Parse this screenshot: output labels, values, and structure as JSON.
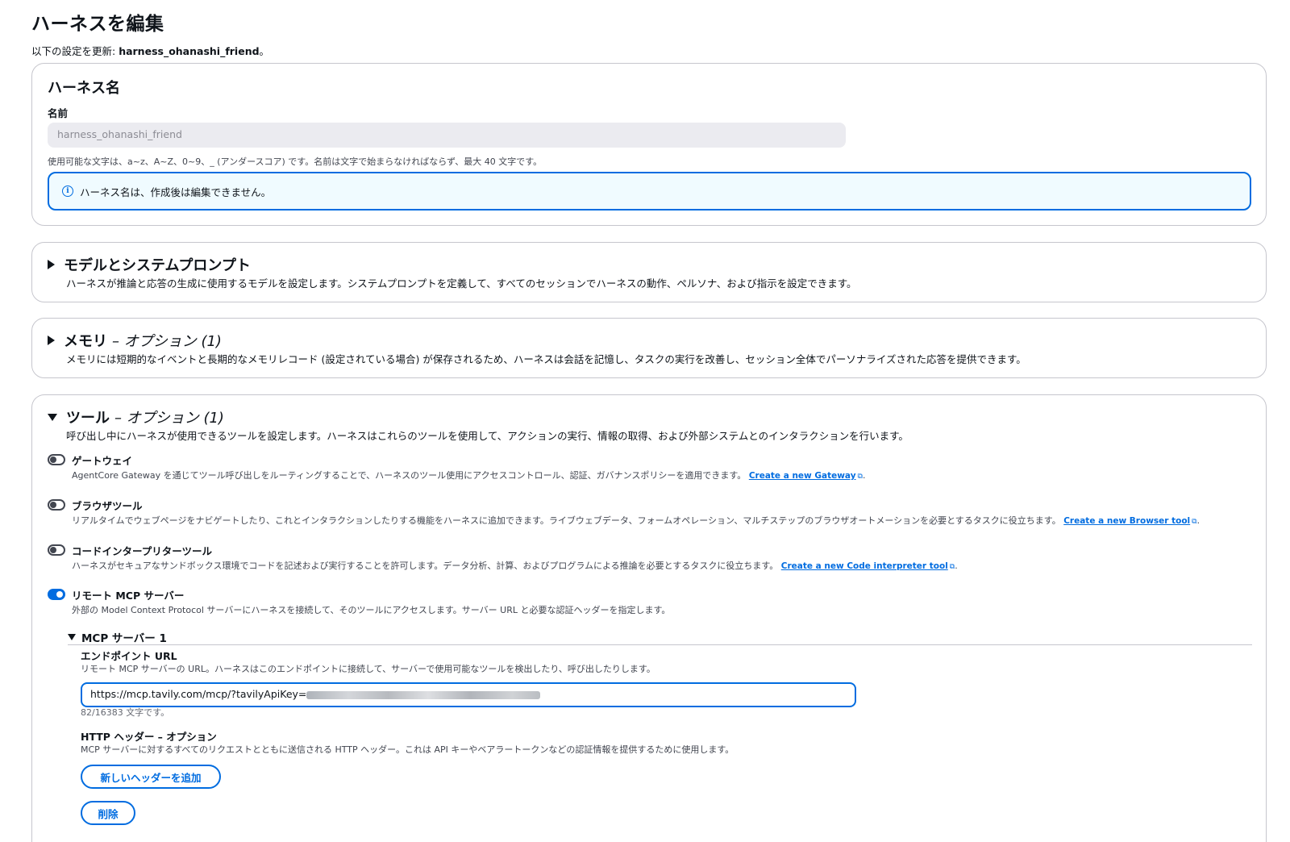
{
  "header": {
    "title": "ハーネスを編集",
    "subtitle_prefix": "以下の設定を更新: ",
    "subtitle_name": "harness_ohanashi_friend",
    "subtitle_suffix": "。"
  },
  "name_panel": {
    "title": "ハーネス名",
    "label": "名前",
    "input_value": "harness_ohanashi_friend",
    "hint": "使用可能な文字は、a~z、A~Z、0~9、_ (アンダースコア) です。名前は文字で始まらなければならず、最大 40 文字です。",
    "info_icon": "i",
    "info_text": "ハーネス名は、作成後は編集できません。"
  },
  "model_panel": {
    "title": "モデルとシステムプロンプト",
    "description": "ハーネスが推論と応答の生成に使用するモデルを設定します。システムプロンプトを定義して、すべてのセッションでハーネスの動作、ペルソナ、および指示を設定できます。"
  },
  "memory_panel": {
    "title": "メモリ",
    "optional": "– オプション (1)",
    "description": "メモリには短期的なイベントと長期的なメモリレコード (設定されている場合) が保存されるため、ハーネスは会話を記憶し、タスクの実行を改善し、セッション全体でパーソナライズされた応答を提供できます。"
  },
  "tools_panel": {
    "title": "ツール",
    "optional": "– オプション (1)",
    "description": "呼び出し中にハーネスが使用できるツールを設定します。ハーネスはこれらのツールを使用して、アクションの実行、情報の取得、および外部システムとのインタラクションを行います。",
    "gateway": {
      "label": "ゲートウェイ",
      "enabled": false,
      "description": "AgentCore Gateway を通じてツール呼び出しをルーティングすることで、ハーネスのツール使用にアクセスコントロール、認証、ガバナンスポリシーを適用できます。",
      "link": "Create a new Gateway"
    },
    "browser": {
      "label": "ブラウザツール",
      "enabled": false,
      "description": "リアルタイムでウェブページをナビゲートしたり、これとインタラクションしたりする機能をハーネスに追加できます。ライブウェブデータ、フォームオペレーション、マルチステップのブラウザオートメーションを必要とするタスクに役立ちます。",
      "link": "Create a new Browser tool"
    },
    "code": {
      "label": "コードインタープリターツール",
      "enabled": false,
      "description": "ハーネスがセキュアなサンドボックス環境でコードを記述および実行することを許可します。データ分析、計算、およびプログラムによる推論を必要とするタスクに役立ちます。",
      "link": "Create a new Code interpreter tool"
    },
    "mcp": {
      "label": "リモート MCP サーバー",
      "enabled": true,
      "description": "外部の Model Context Protocol サーバーにハーネスを接続して、そのツールにアクセスします。サーバー URL と必要な認証ヘッダーを指定します。",
      "server_title": "MCP サーバー 1",
      "endpoint_label": "エンドポイント URL",
      "endpoint_desc": "リモート MCP サーバーの URL。ハーネスはこのエンドポイントに接続して、サーバーで使用可能なツールを検出したり、呼び出したりします。",
      "endpoint_value": "https://mcp.tavily.com/mcp/?tavilyApiKey=",
      "char_count": "82/16383 文字です。",
      "headers_label": "HTTP ヘッダー – オプション",
      "headers_desc": "MCP サーバーに対するすべてのリクエストとともに送信される HTTP ヘッダー。これは API キーやベアラートークンなどの認証情報を提供するために使用します。",
      "add_header_button": "新しいヘッダーを追加",
      "delete_button": "削除"
    }
  },
  "icons": {
    "external_link": "external-link-icon",
    "info": "info-icon"
  },
  "colors": {
    "accent": "#006ce0",
    "info_bg": "#f0fbff",
    "disabled_input_bg": "#ebebf0"
  }
}
